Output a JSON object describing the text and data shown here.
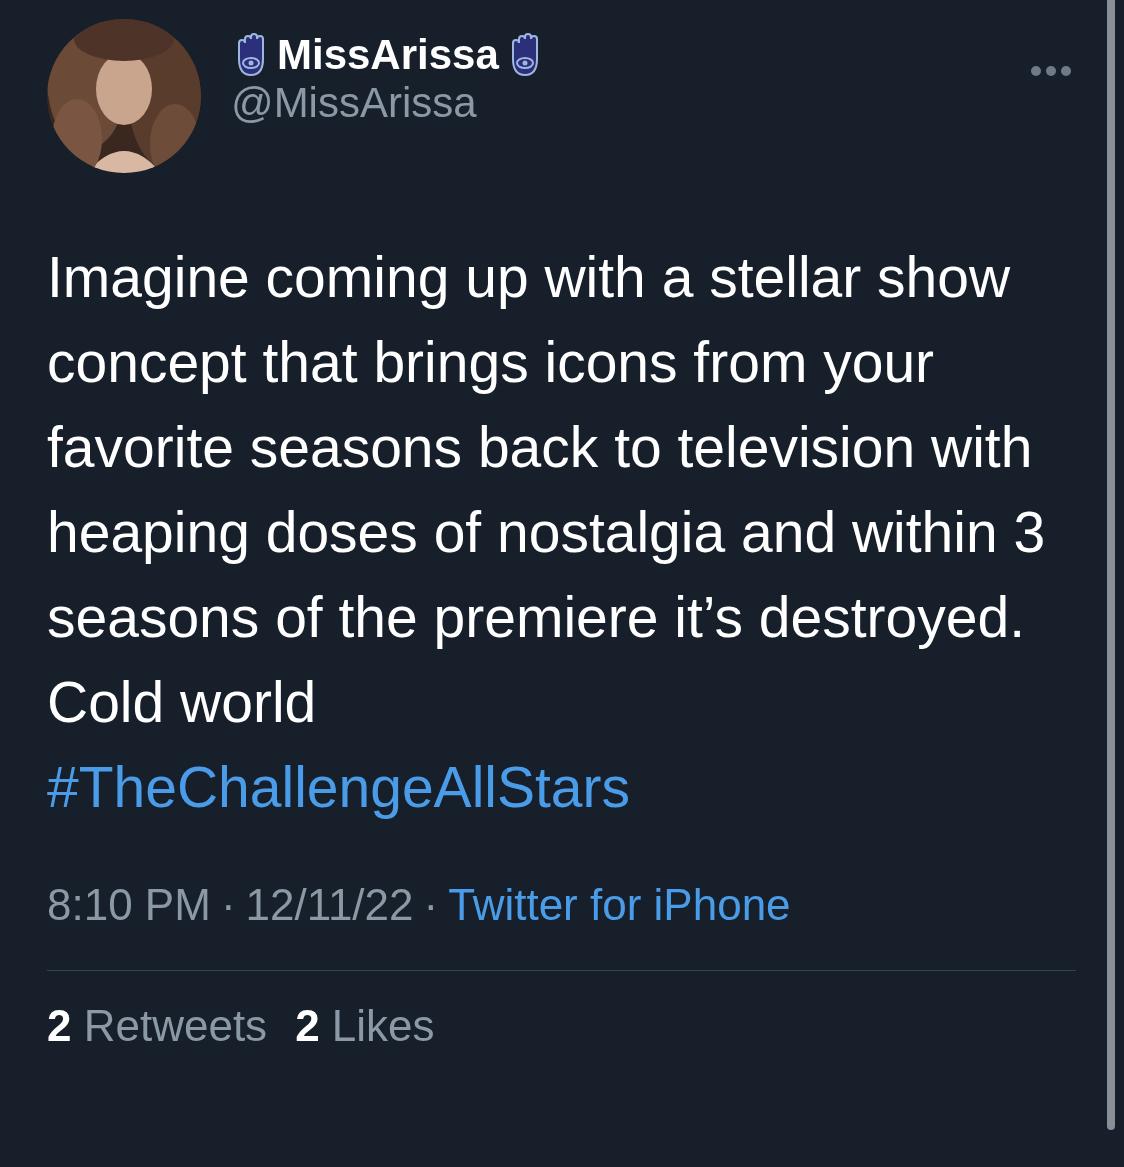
{
  "author": {
    "display_name": "MissArissa",
    "handle": "@MissArissa"
  },
  "tweet": {
    "text": "Imagine coming up with a stellar show concept that brings icons from your favorite seasons back to television with heaping doses of nostalgia and within 3 seasons of the premiere it’s destroyed.\nCold world",
    "hashtag": "#TheChallengeAllStars"
  },
  "meta": {
    "time": "8:10 PM",
    "separator_1": "·",
    "date": "12/11/22",
    "separator_2": "·",
    "source": "Twitter for iPhone"
  },
  "stats": [
    {
      "count": "2",
      "label": "Retweets"
    },
    {
      "count": "2",
      "label": "Likes"
    }
  ]
}
